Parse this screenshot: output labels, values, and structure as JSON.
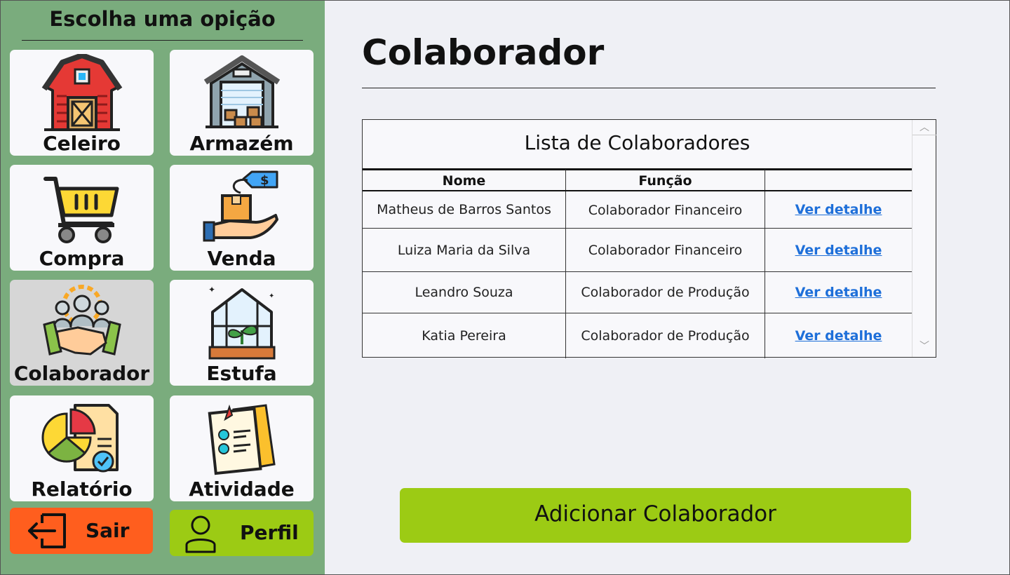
{
  "sidebar": {
    "title": "Escolha uma opição",
    "tiles": [
      {
        "label": "Celeiro",
        "icon": "barn-icon"
      },
      {
        "label": "Armazém",
        "icon": "warehouse-icon"
      },
      {
        "label": "Compra",
        "icon": "shopping-cart-icon"
      },
      {
        "label": "Venda",
        "icon": "sale-hand-box-icon"
      },
      {
        "label": "Colaborador",
        "icon": "team-handshake-icon"
      },
      {
        "label": "Estufa",
        "icon": "greenhouse-icon"
      },
      {
        "label": "Relatório",
        "icon": "report-pie-chart-icon"
      },
      {
        "label": "Atividade",
        "icon": "task-checklist-icon"
      }
    ],
    "exit": {
      "label": "Sair",
      "icon": "logout-icon",
      "color": "#ff5e1e"
    },
    "profile": {
      "label": "Perfil",
      "icon": "user-icon",
      "color": "#9ccb14"
    }
  },
  "main": {
    "title": "Colaborador",
    "list": {
      "title": "Lista de Colaboradores",
      "columns": [
        "Nome",
        "Função",
        ""
      ],
      "rows": [
        {
          "name": "Matheus de Barros Santos",
          "role": "Colaborador Financeiro",
          "action": "Ver detalhe"
        },
        {
          "name": "Luiza Maria da Silva",
          "role": "Colaborador Financeiro",
          "action": "Ver detalhe"
        },
        {
          "name": "Leandro Souza",
          "role": "Colaborador de Produção",
          "action": "Ver detalhe"
        },
        {
          "name": "Katia Pereira",
          "role": "Colaborador de Produção",
          "action": "Ver detalhe"
        }
      ]
    },
    "add_button": "Adicionar Colaborador"
  },
  "colors": {
    "sidebar_bg": "#7aac7d",
    "tile_bg": "#f8f8fb",
    "active_tile_bg": "#d6d6d6",
    "link": "#1e6fd9",
    "accent_green": "#9ccb14",
    "accent_orange": "#ff5e1e"
  }
}
